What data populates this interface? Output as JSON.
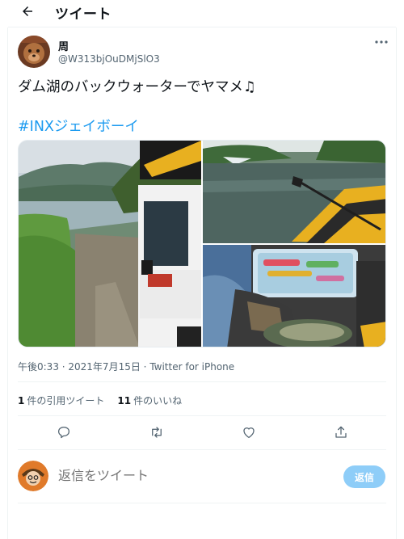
{
  "header": {
    "title": "ツイート",
    "back_icon": "arrow-left-icon"
  },
  "tweet": {
    "display_name": "周",
    "handle": "@W313bjOuDMjSlO3",
    "text": "ダム湖のバックウォーターでヤマメ♫",
    "hashtag": "#INXジェイボーイ",
    "timestamp": "午後0:33 · 2021年7月15日",
    "source": "Twitter for iPhone",
    "more_icon": "more-horizontal-icon"
  },
  "stats": {
    "quote_count": "1",
    "quote_label": "件の引用ツイート",
    "like_count": "11",
    "like_label": "件のいいね"
  },
  "actions": [
    "reply-icon",
    "retweet-icon",
    "like-icon",
    "share-icon"
  ],
  "reply_box": {
    "placeholder": "返信をツイート",
    "button_label": "返信"
  },
  "colors": {
    "accent": "#1d9bf0",
    "reply_button_disabled": "#8ecdf8",
    "secondary_text": "#536471",
    "divider": "#eff3f4"
  }
}
